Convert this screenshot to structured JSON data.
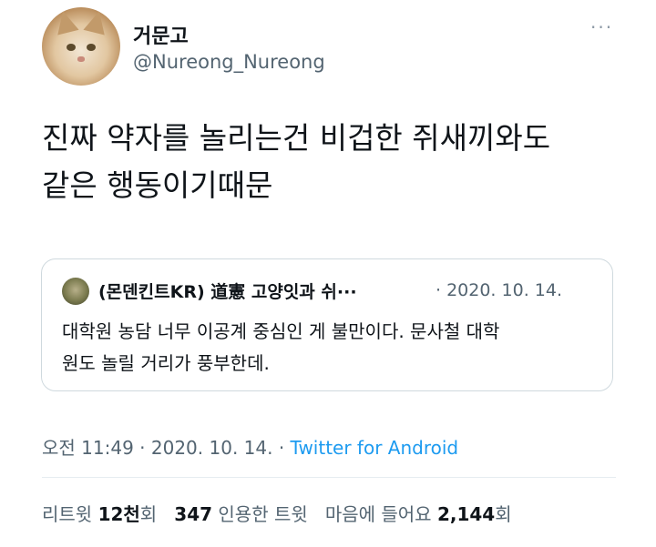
{
  "author": {
    "display_name": "거문고",
    "handle": "@Nureong_Nureong",
    "avatar_icon": "cat-avatar"
  },
  "more_label": "···",
  "tweet": {
    "line1": "진짜 약자를 놀리는건 비겁한 쥐새끼와도",
    "line2": "같은 행동이기때문"
  },
  "quote": {
    "avatar_icon": "user-avatar",
    "author": "(몬덴킨트KR) 道憲 고양잇과 쉬···",
    "date": "· 2020. 10. 14.",
    "line1": "대학원 농담 너무 이공계 중심인 게 불만이다. 문사철 대학",
    "line2": "원도 놀릴 거리가 풍부한데."
  },
  "meta": {
    "time": "오전 11:49",
    "sep1": " · ",
    "date": "2020. 10. 14.",
    "sep2": " · ",
    "source": "Twitter for Android",
    "source_color": "#1d9bf0"
  },
  "stats": {
    "retweet_label": "리트윗 ",
    "retweet_num": "12천",
    "retweet_unit": "회",
    "quote_num": "347",
    "quote_label": " 인용한 트윗",
    "like_label": "마음에 들어요 ",
    "like_num": "2,144",
    "like_unit": "회"
  }
}
